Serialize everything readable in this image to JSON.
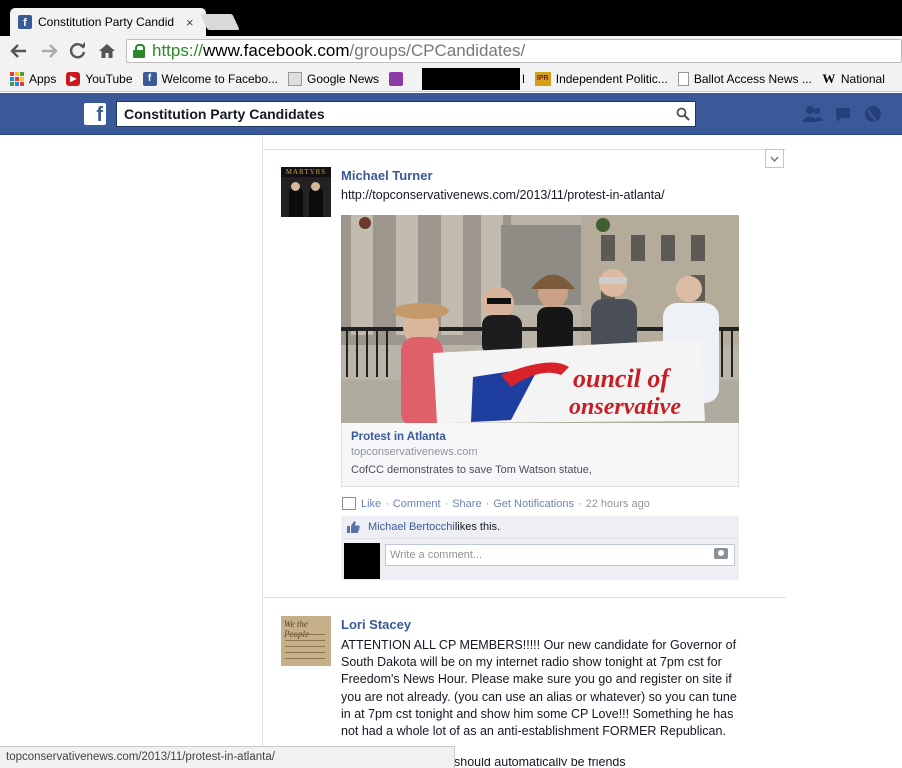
{
  "browser": {
    "tab_title": "Constitution Party Candid",
    "tab_close": "×",
    "url_https": "https://",
    "url_host": "www.facebook.com",
    "url_path": "/groups/CPCandidates/",
    "bookmarks": [
      {
        "label": "Apps",
        "icon": "apps-grid-icon"
      },
      {
        "label": "YouTube",
        "icon": "youtube-icon"
      },
      {
        "label": "Welcome to Facebo...",
        "icon": "facebook-icon"
      },
      {
        "label": "Google News",
        "icon": "news-icon"
      },
      {
        "label": "",
        "icon": "mail-icon"
      },
      {
        "label": "l",
        "icon": "redacted"
      },
      {
        "label": "Independent Politic...",
        "icon": "ipr-icon"
      },
      {
        "label": "Ballot Access News ...",
        "icon": "page-icon"
      },
      {
        "label": "National",
        "icon": "wikipedia-icon"
      }
    ],
    "status_url": "topconservativenews.com/2013/11/protest-in-atlanta/"
  },
  "facebook": {
    "search_value": "Constitution Party Candidates",
    "colors": {
      "brand": "#3b5998",
      "link": "#3b5998",
      "meta": "#90949c"
    }
  },
  "post1": {
    "author": "Michael Turner",
    "avatar_text": "MARTYRS",
    "link_text": "http://topconservativenews.com/2013/11/protest-in-atlanta/",
    "banner_text_line1": "ouncil of",
    "banner_text_line2": "onservative",
    "card": {
      "title": "Protest in Atlanta",
      "domain": "topconservativenews.com",
      "description": "CofCC demonstrates to save Tom Watson statue,"
    },
    "actions": {
      "like": "Like",
      "comment": "Comment",
      "share": "Share",
      "notifications": "Get Notifications",
      "time": "22 hours ago",
      "separator": "·"
    },
    "likes": {
      "who": "Michael Bertocchi",
      "suffix": " likes this."
    },
    "comment_placeholder": "Write a comment..."
  },
  "post2": {
    "author": "Lori Stacey",
    "avatar_text": "We the People",
    "lines": [
      "ATTENTION ALL CP MEMBERS!!!!! Our new candidate for Governor of",
      "South Dakota will be on my internet radio show tonight at 7pm cst for",
      "Freedom's News Hour. Please make sure you go and register on site if",
      "you are not already. (you can use an alias or whatever) so you can tune",
      "in at 7pm cst tonight and show him some CP Love!!! Something he has",
      "not had a whole lot of as an anti-establishment FORMER Republican."
    ],
    "cut_line": "should automatically be friends"
  }
}
